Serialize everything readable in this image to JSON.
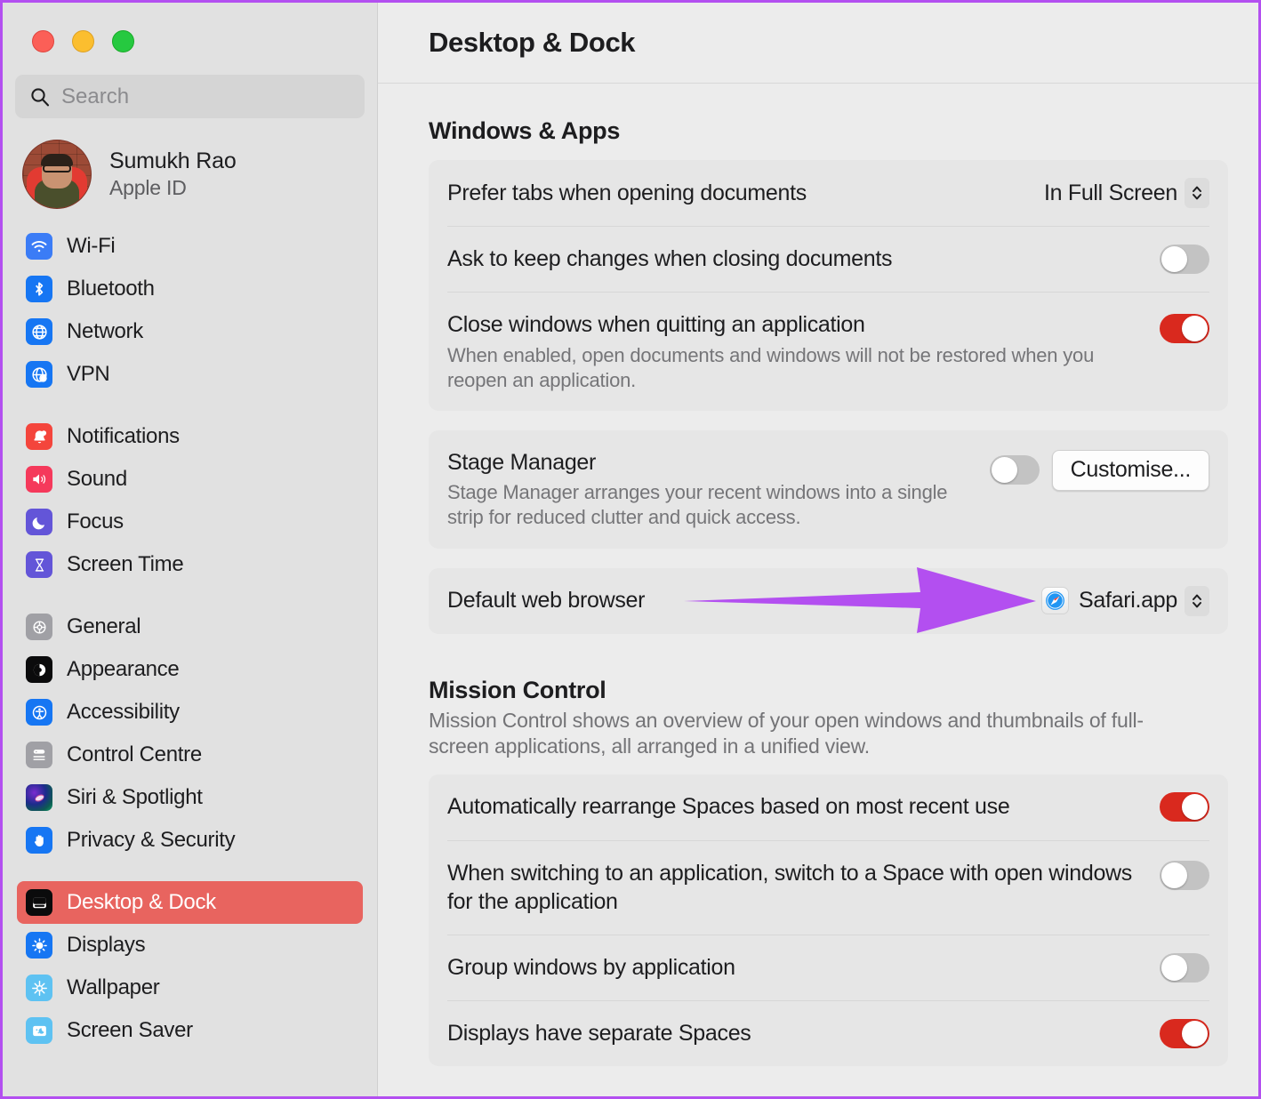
{
  "window": {
    "title": "Desktop & Dock",
    "traffic_lights": [
      "close-button",
      "minimise-button",
      "zoom-button"
    ],
    "accent_highlight": "#e8645f",
    "toggle_on_color": "#d9291e",
    "annotation_color": "#b34ff0"
  },
  "sidebar": {
    "search": {
      "placeholder": "Search",
      "value": "",
      "icon": "search-icon"
    },
    "account": {
      "name": "Sumukh Rao",
      "subtitle": "Apple ID",
      "avatar": "user-avatar"
    },
    "groups": [
      {
        "items": [
          {
            "label": "Wi-Fi",
            "icon": "wifi-icon",
            "selected": false
          },
          {
            "label": "Bluetooth",
            "icon": "bluetooth-icon",
            "selected": false
          },
          {
            "label": "Network",
            "icon": "globe-icon",
            "selected": false
          },
          {
            "label": "VPN",
            "icon": "vpn-globe-icon",
            "selected": false
          }
        ]
      },
      {
        "items": [
          {
            "label": "Notifications",
            "icon": "bell-icon",
            "selected": false
          },
          {
            "label": "Sound",
            "icon": "speaker-icon",
            "selected": false
          },
          {
            "label": "Focus",
            "icon": "moon-icon",
            "selected": false
          },
          {
            "label": "Screen Time",
            "icon": "hourglass-icon",
            "selected": false
          }
        ]
      },
      {
        "items": [
          {
            "label": "General",
            "icon": "gear-icon",
            "selected": false
          },
          {
            "label": "Appearance",
            "icon": "appearance-icon",
            "selected": false
          },
          {
            "label": "Accessibility",
            "icon": "accessibility-icon",
            "selected": false
          },
          {
            "label": "Control Centre",
            "icon": "control-centre-icon",
            "selected": false
          },
          {
            "label": "Siri & Spotlight",
            "icon": "siri-icon",
            "selected": false
          },
          {
            "label": "Privacy & Security",
            "icon": "hand-icon",
            "selected": false
          }
        ]
      },
      {
        "items": [
          {
            "label": "Desktop & Dock",
            "icon": "desktop-dock-icon",
            "selected": true
          },
          {
            "label": "Displays",
            "icon": "brightness-icon",
            "selected": false
          },
          {
            "label": "Wallpaper",
            "icon": "wallpaper-icon",
            "selected": false
          },
          {
            "label": "Screen Saver",
            "icon": "screensaver-icon",
            "selected": false
          }
        ]
      }
    ]
  },
  "main": {
    "sections": [
      {
        "title": "Windows & Apps",
        "description": "",
        "cards": [
          {
            "rows": [
              {
                "label": "Prefer tabs when opening documents",
                "sub": "",
                "control": "popup",
                "value": "In Full Screen"
              },
              {
                "label": "Ask to keep changes when closing documents",
                "sub": "",
                "control": "toggle",
                "value": "off"
              },
              {
                "label": "Close windows when quitting an application",
                "sub": "When enabled, open documents and windows will not be restored when you reopen an application.",
                "control": "toggle",
                "value": "on"
              }
            ]
          },
          {
            "rows": [
              {
                "label": "Stage Manager",
                "sub": "Stage Manager arranges your recent windows into a single strip for reduced clutter and quick access.",
                "control": "toggle-and-button",
                "value": "off",
                "button_label": "Customise..."
              }
            ]
          },
          {
            "rows": [
              {
                "label": "Default web browser",
                "sub": "",
                "control": "app-popup",
                "value": "Safari.app",
                "app_icon": "safari-icon"
              }
            ]
          }
        ]
      },
      {
        "title": "Mission Control",
        "description": "Mission Control shows an overview of your open windows and thumbnails of full-screen applications, all arranged in a unified view.",
        "cards": [
          {
            "rows": [
              {
                "label": "Automatically rearrange Spaces based on most recent use",
                "sub": "",
                "control": "toggle",
                "value": "on"
              },
              {
                "label": "When switching to an application, switch to a Space with open windows for the application",
                "sub": "",
                "control": "toggle",
                "value": "off"
              },
              {
                "label": "Group windows by application",
                "sub": "",
                "control": "toggle",
                "value": "off"
              },
              {
                "label": "Displays have separate Spaces",
                "sub": "",
                "control": "toggle",
                "value": "on"
              }
            ]
          }
        ]
      }
    ]
  },
  "annotation": {
    "type": "arrow",
    "points_to": "Default web browser value",
    "color": "#b34ff0"
  }
}
